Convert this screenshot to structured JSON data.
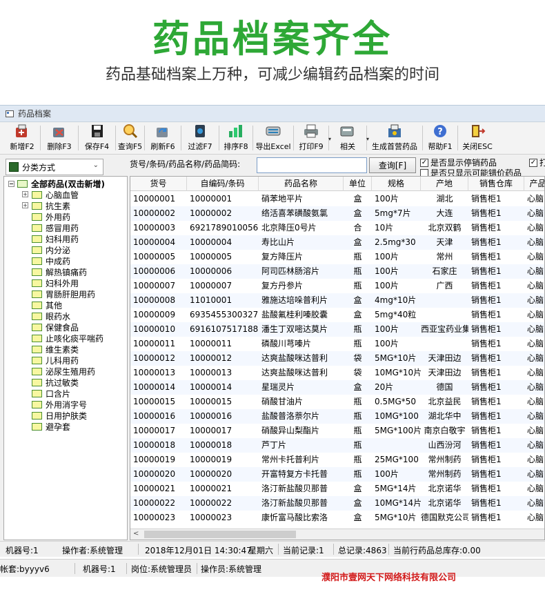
{
  "promo": {
    "title": "药品档案齐全",
    "subtitle": "药品基础档案上万种，可减少编辑药品档案的时间"
  },
  "window": {
    "title": "药品档案"
  },
  "toolbar": {
    "items": [
      {
        "label": "新增F2",
        "icon": "new-drug-icon"
      },
      {
        "label": "删除F3",
        "icon": "delete-icon"
      },
      {
        "label": "保存F4",
        "icon": "save-icon"
      },
      {
        "label": "查询F5",
        "icon": "search-icon"
      },
      {
        "label": "刷新F6",
        "icon": "refresh-icon"
      },
      {
        "label": "过滤F7",
        "icon": "filter-icon"
      },
      {
        "label": "排序F8",
        "icon": "sort-icon"
      },
      {
        "label": "导出Excel",
        "icon": "export-excel-icon"
      },
      {
        "label": "打印F9",
        "icon": "print-icon"
      },
      {
        "label": "相关",
        "icon": "related-icon"
      },
      {
        "label": "生成首营药品",
        "icon": "first-drug-icon"
      },
      {
        "label": "帮助F1",
        "icon": "help-icon"
      },
      {
        "label": "关闭ESC",
        "icon": "close-icon"
      }
    ]
  },
  "filter": {
    "classify_label": "分类方式",
    "search_label": "货号/条码/药品名称/药品简码:",
    "search_value": "",
    "query_label": "查询[F]",
    "chk_stopped": "是否显示停销药品",
    "chk_stopped_checked": true,
    "chk_misplaced": "是否只显示可能错价药品",
    "chk_misplaced_checked": false,
    "chk_extra": "打",
    "chk_extra_checked": true
  },
  "tree": {
    "root_label": "全部药品(双击新增)",
    "items": [
      {
        "label": "心脑血管",
        "expandable": true
      },
      {
        "label": "抗生素",
        "expandable": true
      },
      {
        "label": "外用药",
        "expandable": false
      },
      {
        "label": "感冒用药",
        "expandable": false
      },
      {
        "label": "妇科用药",
        "expandable": false
      },
      {
        "label": "内分泌",
        "expandable": false
      },
      {
        "label": "中成药",
        "expandable": false
      },
      {
        "label": "解热镇痛药",
        "expandable": false
      },
      {
        "label": "妇科外用",
        "expandable": false
      },
      {
        "label": "胃肠肝胆用药",
        "expandable": false
      },
      {
        "label": "其他",
        "expandable": false
      },
      {
        "label": "眼药水",
        "expandable": false
      },
      {
        "label": "保健食品",
        "expandable": false
      },
      {
        "label": "止咳化痰平喘药",
        "expandable": false
      },
      {
        "label": "维生素类",
        "expandable": false
      },
      {
        "label": "儿科用药",
        "expandable": false
      },
      {
        "label": "泌尿生殖用药",
        "expandable": false
      },
      {
        "label": "抗过敏类",
        "expandable": false
      },
      {
        "label": "口含片",
        "expandable": false
      },
      {
        "label": "外用消字号",
        "expandable": false
      },
      {
        "label": "日用护肤类",
        "expandable": false
      },
      {
        "label": "避孕套",
        "expandable": false
      }
    ]
  },
  "grid": {
    "columns": [
      "货号",
      "自编码/条码",
      "药品名称",
      "单位",
      "规格",
      "产地",
      "销售仓库",
      "产品"
    ],
    "rows": [
      [
        "10000001",
        "10000001",
        "硝苯地平片",
        "盒",
        "100片",
        "湖北",
        "销售柜1",
        "心脑"
      ],
      [
        "10000002",
        "10000002",
        "络活喜苯磺酸氨氯",
        "盒",
        "5mg*7片",
        "大连",
        "销售柜1",
        "心脑"
      ],
      [
        "10000003",
        "6921789010056",
        "北京降压0号片",
        "合",
        "10片",
        "北京双鹤",
        "销售柜1",
        "心脑"
      ],
      [
        "10000004",
        "10000004",
        "寿比山片",
        "盒",
        "2.5mg*30",
        "天津",
        "销售柜1",
        "心脑"
      ],
      [
        "10000005",
        "10000005",
        "复方降压片",
        "瓶",
        "100片",
        "常州",
        "销售柜1",
        "心脑"
      ],
      [
        "10000006",
        "10000006",
        "阿司匹林肠溶片",
        "瓶",
        "100片",
        "石家庄",
        "销售柜1",
        "心脑"
      ],
      [
        "10000007",
        "10000007",
        "复方丹参片",
        "瓶",
        "100片",
        "广西",
        "销售柜1",
        "心脑"
      ],
      [
        "10000008",
        "11010001",
        "雅施达培哚普利片",
        "盒",
        "4mg*10片",
        "",
        "销售柜1",
        "心脑"
      ],
      [
        "10000009",
        "6935455300327",
        "盐酸氟桂利嗪胶囊",
        "盒",
        "5mg*40粒",
        "",
        "销售柜1",
        "心脑"
      ],
      [
        "10000010",
        "6916107517188",
        "潘生丁双嘧达莫片",
        "瓶",
        "100片",
        "西亚宝药业集",
        "销售柜1",
        "心脑"
      ],
      [
        "10000011",
        "10000011",
        "磷酸川芎嗪片",
        "瓶",
        "100片",
        "",
        "销售柜1",
        "心脑"
      ],
      [
        "10000012",
        "10000012",
        "达爽盐酸咪达普利",
        "袋",
        "5MG*10片",
        "天津田边",
        "销售柜1",
        "心脑"
      ],
      [
        "10000013",
        "10000013",
        "达爽盐酸咪达普利",
        "袋",
        "10MG*10片",
        "天津田边",
        "销售柜1",
        "心脑"
      ],
      [
        "10000014",
        "10000014",
        "星瑞灵片",
        "盒",
        "20片",
        "德国",
        "销售柜1",
        "心脑"
      ],
      [
        "10000015",
        "10000015",
        "硝酸甘油片",
        "瓶",
        "0.5MG*50",
        "北京益民",
        "销售柜1",
        "心脑"
      ],
      [
        "10000016",
        "10000016",
        "盐酸普洛萘尔片",
        "瓶",
        "10MG*100",
        "湖北华中",
        "销售柜1",
        "心脑"
      ],
      [
        "10000017",
        "10000017",
        "硝酸异山梨酯片",
        "瓶",
        "5MG*100片",
        "南京白敬宇",
        "销售柜1",
        "心脑"
      ],
      [
        "10000018",
        "10000018",
        "芦丁片",
        "瓶",
        "",
        "山西汾河",
        "销售柜1",
        "心脑"
      ],
      [
        "10000019",
        "10000019",
        "常州卡托普利片",
        "瓶",
        "25MG*100",
        "常州制药",
        "销售柜1",
        "心脑"
      ],
      [
        "10000020",
        "10000020",
        "开富特复方卡托普",
        "瓶",
        "100片",
        "常州制药",
        "销售柜1",
        "心脑"
      ],
      [
        "10000021",
        "10000021",
        "洛汀新盐酸贝那普",
        "盒",
        "5MG*14片",
        "北京诺华",
        "销售柜1",
        "心脑"
      ],
      [
        "10000022",
        "10000022",
        "洛汀新盐酸贝那普",
        "盒",
        "10MG*14片",
        "北京诺华",
        "销售柜1",
        "心脑"
      ],
      [
        "10000023",
        "10000023",
        "康忻富马酸比索洛",
        "盒",
        "5MG*10片",
        "德国默克公司",
        "销售柜1",
        "心脑"
      ]
    ]
  },
  "status_bar": {
    "machine": "机器号:1",
    "operator": "操作者:系统管理",
    "datetime": "2018年12月01日 14:30:47",
    "weekday": "星期六",
    "current_record": "当前记录:1",
    "total_records": "总记录:4863",
    "stock": "当前行药品总库存:0.00"
  },
  "outer_status": {
    "account": "帐套:byyyv6",
    "machine": "机器号:1",
    "post": "岗位:系统管理员",
    "operator": "操作员:系统管理"
  },
  "company": "濮阳市壹网天下网络科技有限公司",
  "colors": {
    "title_green": "#2ea836",
    "company_red": "#d21a1a",
    "grid_stripe": "#f4f8ff"
  }
}
